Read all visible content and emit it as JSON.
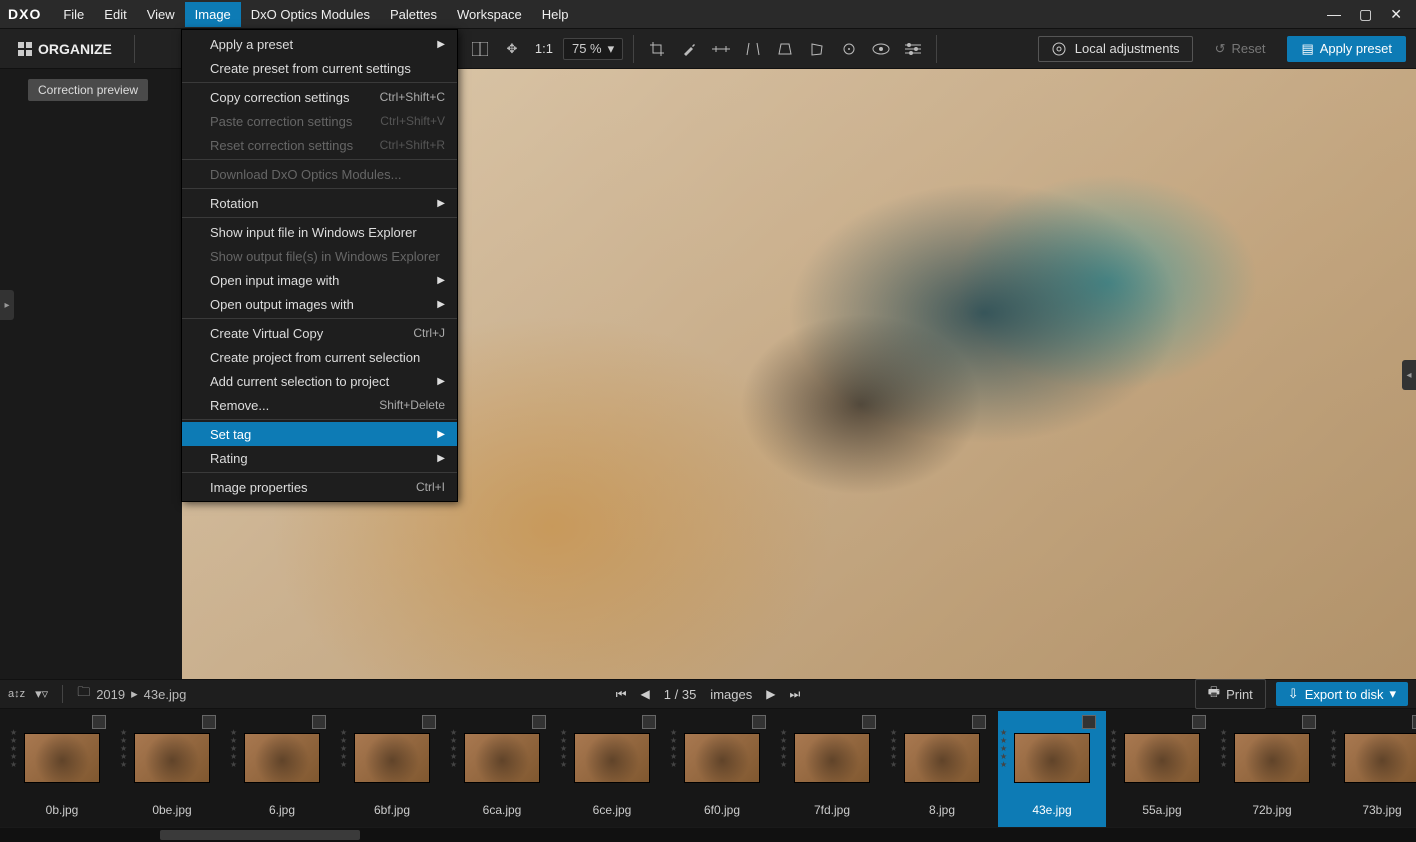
{
  "menubar": {
    "logo": "DXO",
    "items": [
      "File",
      "Edit",
      "View",
      "Image",
      "DxO Optics Modules",
      "Palettes",
      "Workspace",
      "Help"
    ],
    "active_index": 3
  },
  "toolbar": {
    "organize": "ORGANIZE",
    "one_to_one": "1:1",
    "zoom": "75 %",
    "local_adjustments": "Local adjustments",
    "reset": "Reset",
    "apply_preset": "Apply preset"
  },
  "side": {
    "correction_preview": "Correction preview"
  },
  "dropdown": {
    "items": [
      {
        "label": "Apply a preset",
        "submenu": true
      },
      {
        "label": "Create preset from current settings"
      },
      {
        "sep": true
      },
      {
        "label": "Copy correction settings",
        "shortcut": "Ctrl+Shift+C"
      },
      {
        "label": "Paste correction settings",
        "shortcut": "Ctrl+Shift+V",
        "disabled": true
      },
      {
        "label": "Reset correction settings",
        "shortcut": "Ctrl+Shift+R",
        "disabled": true
      },
      {
        "sep": true
      },
      {
        "label": "Download DxO Optics Modules...",
        "disabled": true
      },
      {
        "sep": true
      },
      {
        "label": "Rotation",
        "submenu": true
      },
      {
        "sep": true
      },
      {
        "label": "Show input file in Windows Explorer"
      },
      {
        "label": "Show output file(s) in Windows Explorer",
        "disabled": true
      },
      {
        "label": "Open input image with",
        "submenu": true
      },
      {
        "label": "Open output images with",
        "submenu": true
      },
      {
        "sep": true
      },
      {
        "label": "Create Virtual Copy",
        "shortcut": "Ctrl+J"
      },
      {
        "label": "Create project from current selection"
      },
      {
        "label": "Add current selection to project",
        "submenu": true
      },
      {
        "label": "Remove...",
        "shortcut": "Shift+Delete"
      },
      {
        "sep": true
      },
      {
        "label": "Set tag",
        "submenu": true,
        "highlight": true
      },
      {
        "label": "Rating",
        "submenu": true
      },
      {
        "sep": true
      },
      {
        "label": "Image properties",
        "shortcut": "Ctrl+I"
      }
    ]
  },
  "footer": {
    "folder": "2019",
    "file": "43e.jpg",
    "separator": "▸",
    "counter": "1 / 35",
    "counter_label": "images",
    "print": "Print",
    "export": "Export to disk"
  },
  "thumbs": [
    {
      "name": "0b.jpg"
    },
    {
      "name": "0be.jpg"
    },
    {
      "name": "6.jpg"
    },
    {
      "name": "6bf.jpg"
    },
    {
      "name": "6ca.jpg"
    },
    {
      "name": "6ce.jpg"
    },
    {
      "name": "6f0.jpg"
    },
    {
      "name": "7fd.jpg"
    },
    {
      "name": "8.jpg"
    },
    {
      "name": "43e.jpg",
      "selected": true
    },
    {
      "name": "55a.jpg"
    },
    {
      "name": "72b.jpg"
    },
    {
      "name": "73b.jpg"
    }
  ]
}
